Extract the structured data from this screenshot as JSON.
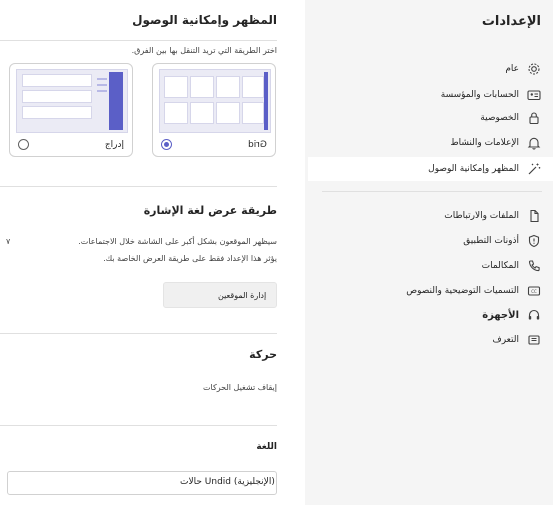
{
  "settings": {
    "title": "الإعدادات",
    "nav": [
      {
        "label": "عام",
        "icon": "gear-icon"
      },
      {
        "label": "الحسابات والمؤسسة",
        "icon": "id-card-icon"
      },
      {
        "label": "الخصوصية",
        "icon": "lock-icon"
      },
      {
        "label": "الإعلامات والنشاط",
        "icon": "bell-icon"
      },
      {
        "label": "المظهر وإمكانية الوصول",
        "icon": "accessibility-wand-icon"
      },
      {
        "label": "الملفات والارتباطات",
        "icon": "file-icon"
      },
      {
        "label": "أذونات التطبيق",
        "icon": "shield-icon"
      },
      {
        "label": "المكالمات",
        "icon": "phone-icon"
      },
      {
        "label": "التسميات التوضيحية والنصوص",
        "icon": "captions-icon"
      },
      {
        "label": "الأجهزة",
        "icon": "headset-icon"
      },
      {
        "label": "التعرف",
        "icon": "recognition-icon"
      }
    ]
  },
  "content": {
    "page_title": "المظهر وإمكانية الوصول",
    "layout_hint": "اختر الطريقة التي تريد التنقل بها بين الفرق.",
    "layout_options": [
      {
        "label": "Grid",
        "selected": true
      },
      {
        "label": "إدراج",
        "selected": false
      }
    ],
    "sign_language": {
      "title": "طريقة عرض لغة الإشارة",
      "desc1": "سيظهر الموقعون بشكل أكبر على الشاشة خلال الاجتماعات.",
      "desc2": "يؤثر هذا الإعداد فقط على طريقة العرض الخاصة بك.",
      "side_mark": "۷",
      "button": "إدارة الموقعين"
    },
    "motion": {
      "title": "حركة",
      "option": "إيقاف تشغيل الحركات"
    },
    "language": {
      "title": "اللغة",
      "value": "حالات Undid (الإنجليزية)"
    }
  }
}
